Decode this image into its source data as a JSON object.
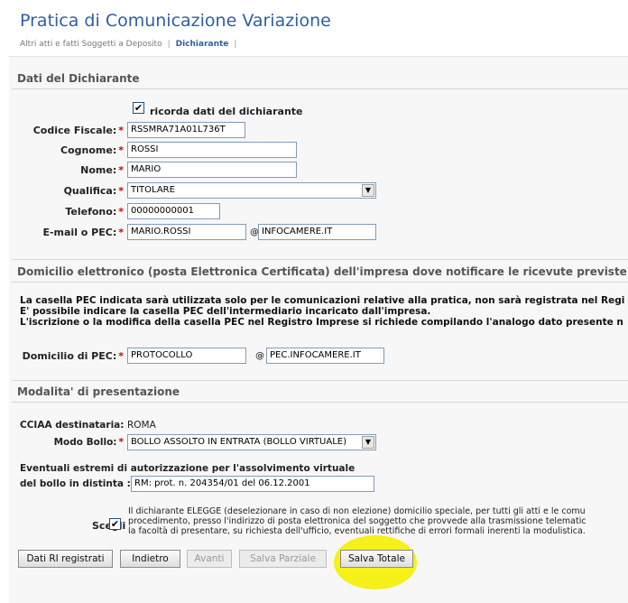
{
  "header": {
    "title": "Pratica di Comunicazione Variazione",
    "breadcrumb": {
      "item1": "Altri atti e fatti Soggetti a Deposito",
      "sep": "|",
      "current": "Dichiarante",
      "sep2": "|"
    }
  },
  "dichiarante": {
    "section_title": "Dati del Dichiarante",
    "remember_label": "ricorda dati del dichiarante",
    "remember_checked": "✔",
    "required_marker": "*",
    "codice_fiscale": {
      "label": "Codice Fiscale:",
      "value": "RSSMRA71A01L736T"
    },
    "cognome": {
      "label": "Cognome:",
      "value": "ROSSI"
    },
    "nome": {
      "label": "Nome:",
      "value": "MARIO"
    },
    "qualifica": {
      "label": "Qualifica:",
      "value": "TITOLARE",
      "arrow": "▼"
    },
    "telefono": {
      "label": "Telefono:",
      "value": "00000000001"
    },
    "email": {
      "label": "E-mail o PEC:",
      "user": "MARIO.ROSSI",
      "at": "@",
      "domain": "INFOCAMERE.IT"
    }
  },
  "domicilio": {
    "section_title": "Domicilio elettronico (posta Elettronica Certificata) dell'impresa dove notificare le ricevute previste",
    "info_lines": [
      "La casella PEC indicata sarà utilizzata solo per le comunicazioni relative alla pratica, non sarà registrata nel Regi",
      "E' possibile indicare la casella PEC dell'intermediario incaricato dall'impresa.",
      "L'iscrizione o la modifica della casella PEC nel Registro Imprese si richiede compilando l'analogo dato presente n"
    ],
    "pec": {
      "label": "Domicilio di PEC:",
      "user": "PROTOCOLLO",
      "at": "@",
      "domain": "PEC.INFOCAMERE.IT"
    }
  },
  "modalita": {
    "section_title": "Modalita' di presentazione",
    "cciaa_label": "CCIAA destinataria:",
    "cciaa_value": "ROMA",
    "bollo": {
      "label": "Modo Bollo:",
      "value": "BOLLO ASSOLTO IN ENTRATA (BOLLO VIRTUALE)",
      "arrow": "▼"
    },
    "estremi_label_line1": "Eventuali estremi di autorizzazione per l'assolvimento virtuale",
    "estremi_label_line2": "del bollo in distinta :",
    "estremi_value": "RM: prot. n. 204354/01 del 06.12.2001",
    "scegli_label": "Scegli",
    "scegli_checked": "✔",
    "scegli_text_lines": [
      "Il dichiarante ELEGGE (deselezionare in caso di non elezione) domicilio speciale, per tutti gli atti e le comu",
      "procedimento, presso l'indirizzo di posta elettronica del soggetto che provvede alla trasmissione telematic",
      "la facoltà di presentare, su richiesta dell'ufficio, eventuali rettifiche di errori formali inerenti la modulistica."
    ]
  },
  "buttons": {
    "dati_ri": "Dati RI registrati",
    "indietro": "Indietro",
    "avanti": "Avanti",
    "salva_parziale": "Salva Parziale",
    "salva_totale": "Salva Totale"
  },
  "colors": {
    "title": "#2f5ea8",
    "required": "#d00000",
    "highlight": "#f4f000",
    "panel_bg": "#f7f7f7"
  }
}
